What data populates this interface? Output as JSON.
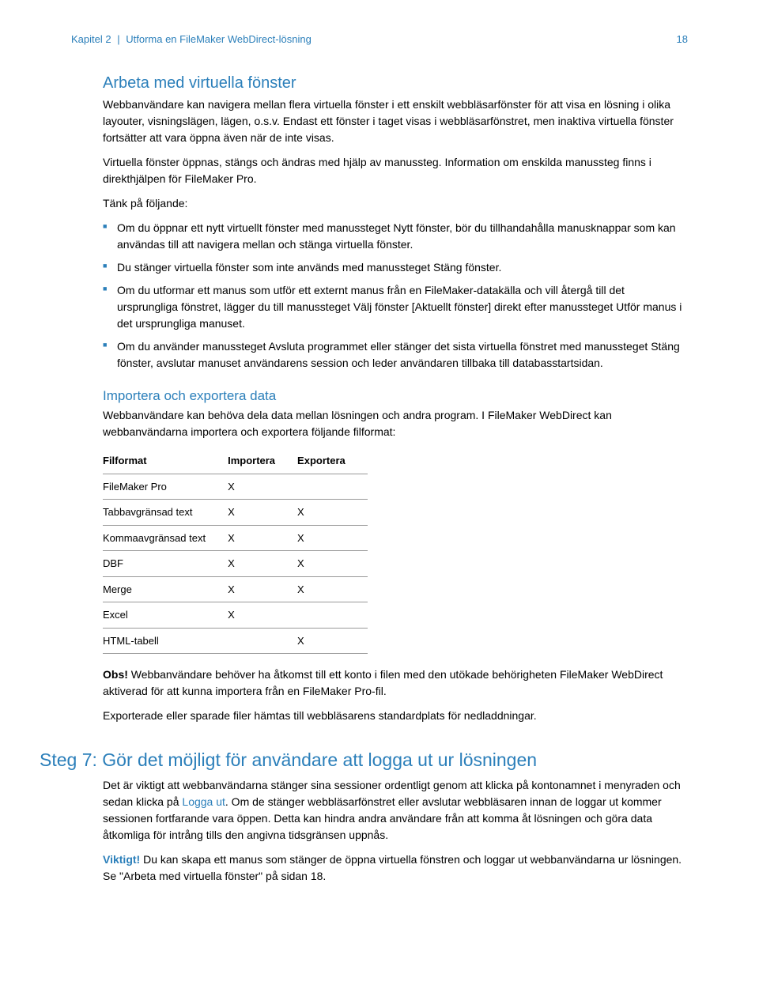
{
  "header": {
    "chapter": "Kapitel 2",
    "title": "Utforma en FileMaker WebDirect-lösning",
    "page_number": "18"
  },
  "section1": {
    "heading": "Arbeta med virtuella fönster",
    "p1": "Webbanvändare kan navigera mellan flera virtuella fönster i ett enskilt webbläsarfönster för att visa en lösning i olika layouter, visningslägen, lägen, o.s.v. Endast ett fönster i taget visas i webbläsarfönstret, men inaktiva virtuella fönster fortsätter att vara öppna även när de inte visas.",
    "p2": "Virtuella fönster öppnas, stängs och ändras med hjälp av manussteg. Information om enskilda manussteg finns i direkthjälpen för FileMaker Pro.",
    "p3": "Tänk på följande:",
    "bullets": [
      "Om du öppnar ett nytt virtuellt fönster med manussteget Nytt fönster, bör du tillhandahålla manusknappar som kan användas till att navigera mellan och stänga virtuella fönster.",
      "Du stänger virtuella fönster som inte används med manussteget Stäng fönster.",
      "Om du utformar ett manus som utför ett externt manus från en FileMaker-datakälla och vill återgå till det ursprungliga fönstret, lägger du till manussteget Välj fönster [Aktuellt fönster] direkt efter manussteget Utför manus i det ursprungliga manuset.",
      "Om du använder manussteget Avsluta programmet eller stänger det sista virtuella fönstret med manussteget Stäng fönster, avslutar manuset användarens session och leder användaren tillbaka till databasstartsidan."
    ]
  },
  "section2": {
    "heading": "Importera och exportera data",
    "p1": "Webbanvändare kan behöva dela data mellan lösningen och andra program. I FileMaker WebDirect kan webbanvändarna importera och exportera följande filformat:",
    "table": {
      "headers": [
        "Filformat",
        "Importera",
        "Exportera"
      ],
      "rows": [
        {
          "name": "FileMaker Pro",
          "imp": "X",
          "exp": ""
        },
        {
          "name": "Tabbavgränsad text",
          "imp": "X",
          "exp": "X"
        },
        {
          "name": "Kommaavgränsad text",
          "imp": "X",
          "exp": "X"
        },
        {
          "name": "DBF",
          "imp": "X",
          "exp": "X"
        },
        {
          "name": "Merge",
          "imp": "X",
          "exp": "X"
        },
        {
          "name": "Excel",
          "imp": "X",
          "exp": ""
        },
        {
          "name": "HTML-tabell",
          "imp": "",
          "exp": "X"
        }
      ]
    },
    "obs_label": "Obs!",
    "obs_text": " Webbanvändare behöver ha åtkomst till ett konto i filen med den utökade behörigheten FileMaker WebDirect aktiverad för att kunna importera från en FileMaker Pro-fil.",
    "p2": "Exporterade eller sparade filer hämtas till webbläsarens standardplats för nedladdningar."
  },
  "step7": {
    "heading": "Steg 7: Gör det möjligt för användare att logga ut ur lösningen",
    "p1a": "Det är viktigt att webbanvändarna stänger sina sessioner ordentligt genom att klicka på kontonamnet i menyraden och sedan klicka på ",
    "p1_logout": "Logga ut",
    "p1b": ". Om de stänger webbläsarfönstret eller avslutar webbläsaren innan de loggar ut kommer sessionen fortfarande vara öppen. Detta kan hindra andra användare från att komma åt lösningen och göra data åtkomliga för intrång tills den angivna tidsgränsen uppnås.",
    "viktigt_label": "Viktigt!",
    "viktigt_text": " Du kan skapa ett manus som stänger de öppna virtuella fönstren och loggar ut webbanvändarna ur lösningen. Se \"Arbeta med virtuella fönster\" på sidan 18."
  }
}
